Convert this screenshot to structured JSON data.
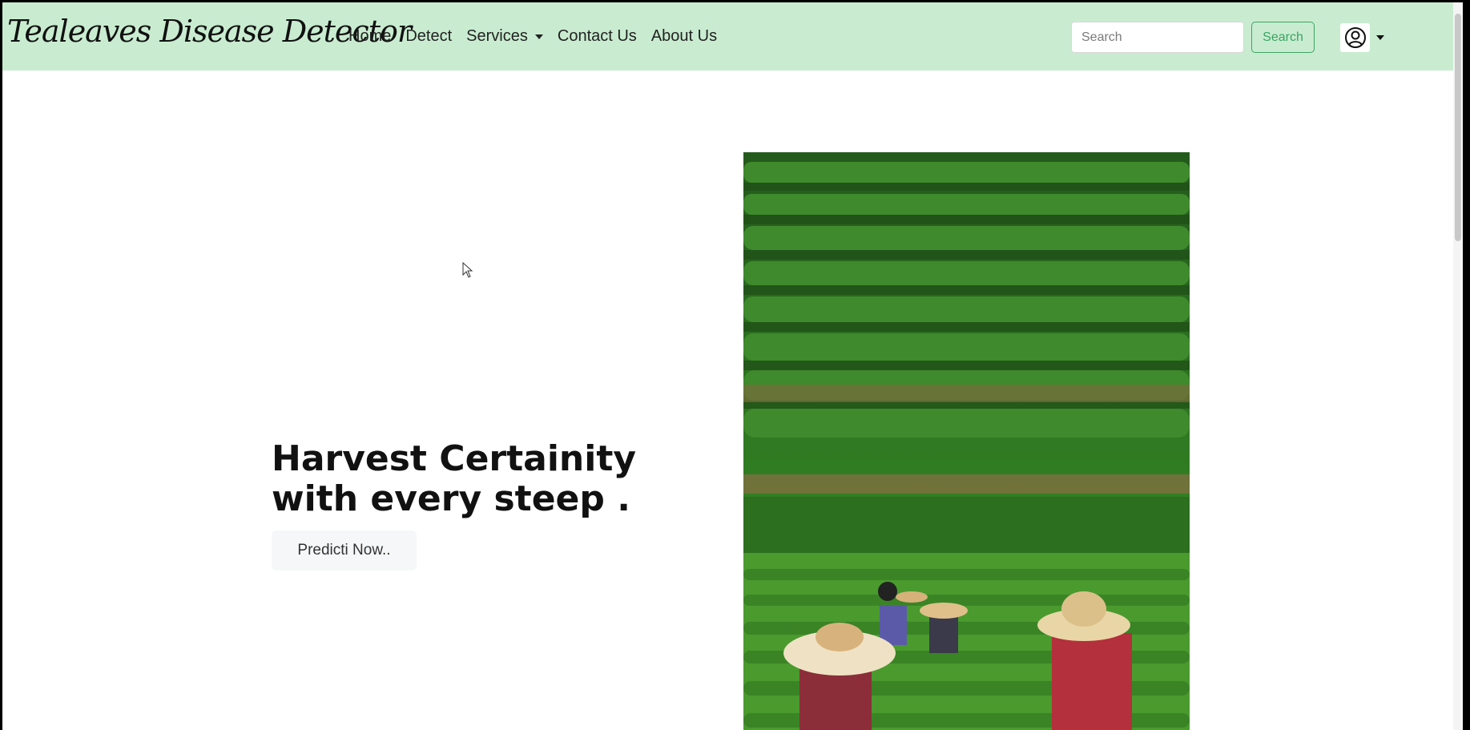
{
  "navbar": {
    "brand": "Tealeaves Disease Detector",
    "links": [
      {
        "label": "Home"
      },
      {
        "label": "Detect"
      },
      {
        "label": "Services",
        "dropdown": true
      },
      {
        "label": "Contact Us"
      },
      {
        "label": "About Us"
      }
    ],
    "search": {
      "placeholder": "Search",
      "value": ""
    },
    "search_button": "Search",
    "user_icon": "user-circle-icon"
  },
  "hero": {
    "title": "Harvest Certainity with every steep .",
    "button_label": "Predicti Now.."
  },
  "colors": {
    "navbar_bg": "#c9ecd0",
    "accent_green": "#3aa463",
    "button_bg": "#f6f7f8"
  }
}
